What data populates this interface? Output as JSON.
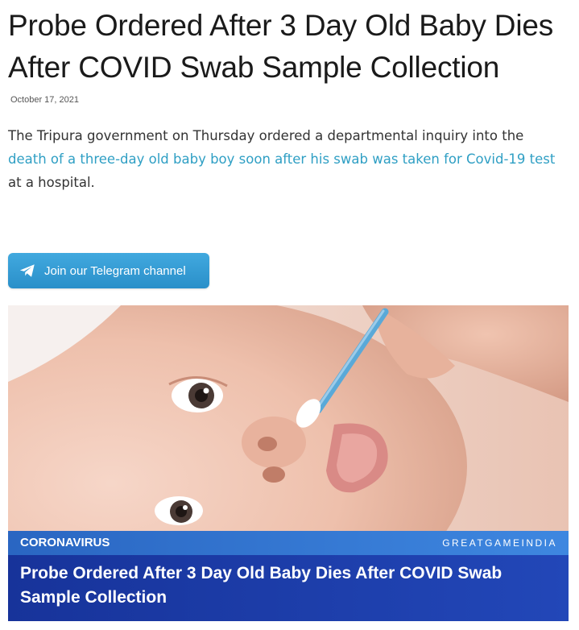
{
  "article": {
    "headline": "Probe Ordered After 3 Day Old Baby Dies After COVID Swab Sample Collection",
    "date": "October 17, 2021",
    "lead": {
      "before_link": "The Tripura government on Thursday ordered a departmental inquiry into the ",
      "link_text": "death of a three-day old baby boy soon after his swab was taken for Covid-19 test",
      "after_link": " at a hospital."
    }
  },
  "telegram_button": {
    "label": "Join our Telegram channel",
    "icon": "paper-plane-icon"
  },
  "hero_image": {
    "category": "CORONAVIRUS",
    "brand": "GREATGAMEINDIA",
    "caption_title": "Probe Ordered After 3 Day Old Baby Dies After COVID Swab Sample Collection"
  },
  "colors": {
    "link": "#2f9fc4",
    "telegram_button": "#35a0d8",
    "banner_top": "#3276d0",
    "banner_bottom": "#1d3ea8"
  }
}
